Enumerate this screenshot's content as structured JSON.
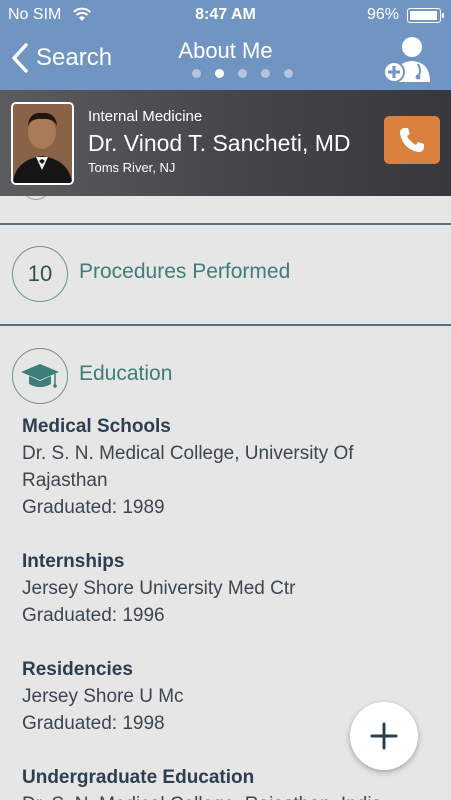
{
  "status_bar": {
    "carrier": "No SIM",
    "time": "8:47 AM",
    "battery": "96%"
  },
  "nav": {
    "back_label": "Search",
    "title": "About Me",
    "page_count": 5,
    "active_page": 2
  },
  "profile": {
    "specialty": "Internal Medicine",
    "name": "Dr. Vinod T. Sancheti, MD",
    "location": "Toms River, NJ"
  },
  "procedures": {
    "count": "10",
    "label": "Procedures Performed"
  },
  "education": {
    "title": "Education",
    "medical_schools": {
      "heading": "Medical Schools",
      "line1": "Dr. S. N. Medical College, University Of",
      "line2": "Rajasthan",
      "graduated": "Graduated:  1989"
    },
    "internships": {
      "heading": "Internships",
      "line1": "Jersey Shore University Med Ctr",
      "graduated": "Graduated:  1996"
    },
    "residencies": {
      "heading": "Residencies",
      "line1": "Jersey Shore U Mc",
      "graduated": "Graduated:  1998"
    },
    "undergraduate": {
      "heading": "Undergraduate Education",
      "line1": "Dr. S. N. Medical College, Rajasthan, India"
    }
  },
  "colors": {
    "header": "#7195c2",
    "accent_teal": "#3e7d78",
    "call_button": "#d9813e",
    "heading_text": "#2d3e50"
  }
}
